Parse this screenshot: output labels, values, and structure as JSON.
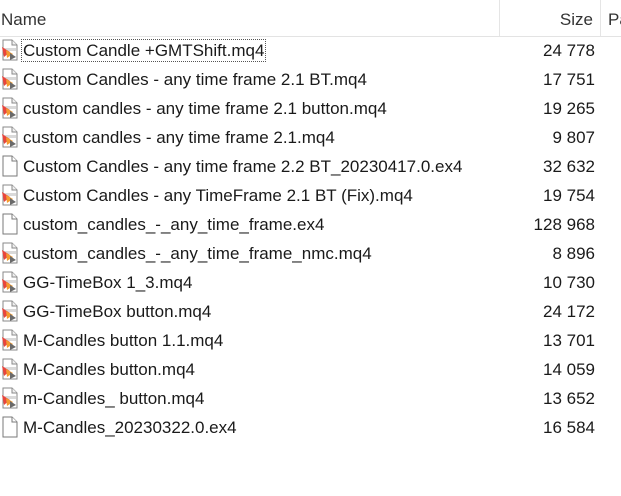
{
  "columns": {
    "name": "Name",
    "size": "Size",
    "extra": "Pa"
  },
  "files": [
    {
      "name": "Custom Candle +GMTShift.mq4",
      "size": "24 778",
      "icon": "mq4-file-icon"
    },
    {
      "name": "Custom Candles - any time frame 2.1 BT.mq4",
      "size": "17 751",
      "icon": "mq4-file-icon"
    },
    {
      "name": "custom candles - any time frame 2.1 button.mq4",
      "size": "19 265",
      "icon": "mq4-file-icon"
    },
    {
      "name": "custom candles - any time frame 2.1.mq4",
      "size": "9 807",
      "icon": "mq4-file-icon"
    },
    {
      "name": "Custom Candles - any time frame 2.2 BT_20230417.0.ex4",
      "size": "32 632",
      "icon": "blank-file-icon"
    },
    {
      "name": "Custom Candles - any TimeFrame 2.1 BT (Fix).mq4",
      "size": "19 754",
      "icon": "mq4-file-icon"
    },
    {
      "name": "custom_candles_-_any_time_frame.ex4",
      "size": "128 968",
      "icon": "blank-file-icon"
    },
    {
      "name": "custom_candles_-_any_time_frame_nmc.mq4",
      "size": "8 896",
      "icon": "mq4-file-icon"
    },
    {
      "name": "GG-TimeBox 1_3.mq4",
      "size": "10 730",
      "icon": "mq4-file-icon"
    },
    {
      "name": "GG-TimeBox button.mq4",
      "size": "24 172",
      "icon": "mq4-file-icon"
    },
    {
      "name": "M-Candles button 1.1.mq4",
      "size": "13 701",
      "icon": "mq4-file-icon"
    },
    {
      "name": "M-Candles button.mq4",
      "size": "14 059",
      "icon": "mq4-file-icon"
    },
    {
      "name": "m-Candles_ button.mq4",
      "size": "13 652",
      "icon": "mq4-file-icon"
    },
    {
      "name": "M-Candles_20230322.0.ex4",
      "size": "16 584",
      "icon": "blank-file-icon"
    }
  ],
  "selected_index": 0
}
